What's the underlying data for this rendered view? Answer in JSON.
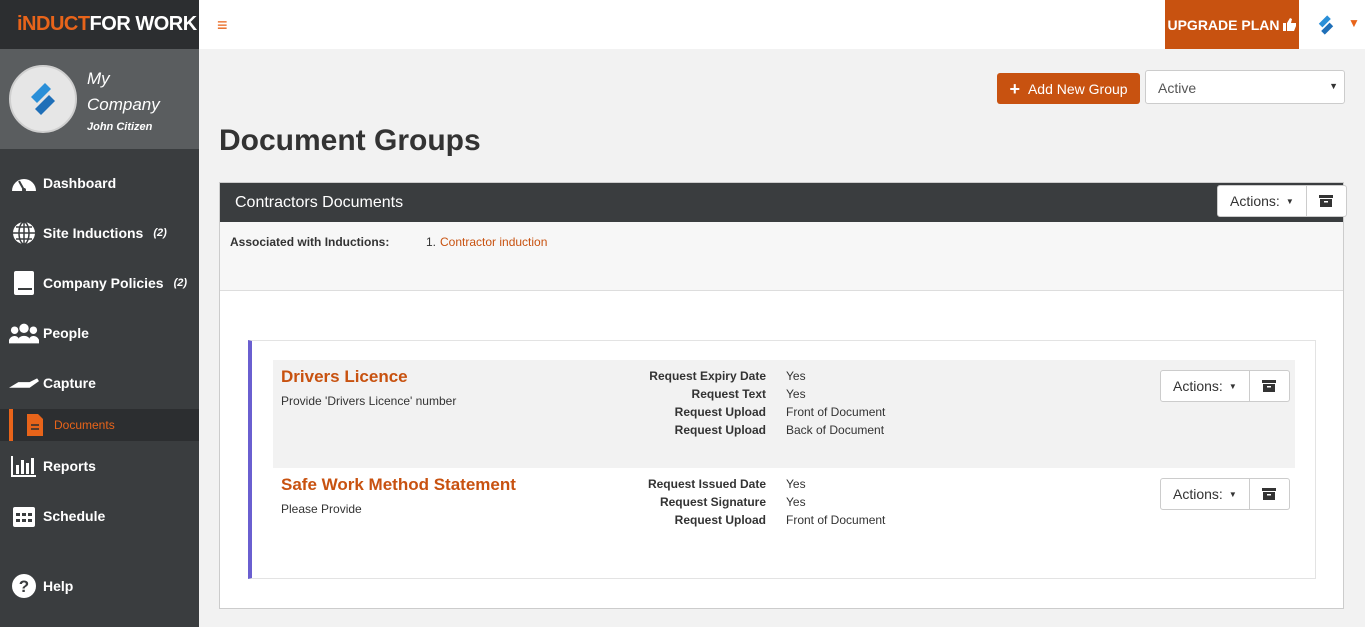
{
  "brand": {
    "part1": "iNDUCT",
    "part2": "FOR WORK"
  },
  "profile": {
    "company": "My Company",
    "user": "John Citizen"
  },
  "nav": {
    "dashboard": "Dashboard",
    "site_inductions": "Site Inductions",
    "site_inductions_count": "(2)",
    "company_policies": "Company Policies",
    "company_policies_count": "(2)",
    "people": "People",
    "capture": "Capture",
    "documents": "Documents",
    "reports": "Reports",
    "schedule": "Schedule",
    "help": "Help"
  },
  "topbar": {
    "menu_glyph": "≡",
    "upgrade_label": "UPGRADE PLAN"
  },
  "toolbar": {
    "add_group_label": "Add New Group",
    "status_value": "Active"
  },
  "page": {
    "title": "Document Groups"
  },
  "group": {
    "name": "Contractors Documents",
    "actions_label": "Actions:",
    "assoc_label": "Associated with Inductions:",
    "assoc_index": "1.",
    "assoc_link": "Contractor induction"
  },
  "documents": [
    {
      "title": "Drivers Licence",
      "desc": "Provide 'Drivers Licence' number",
      "actions_label": "Actions:",
      "props": [
        {
          "k": "Request Expiry Date",
          "v": "Yes"
        },
        {
          "k": "Request Text",
          "v": "Yes"
        },
        {
          "k": "Request Upload",
          "v": "Front of Document"
        },
        {
          "k": "Request Upload",
          "v": "Back of Document"
        }
      ]
    },
    {
      "title": "Safe Work Method Statement",
      "desc": "Please Provide",
      "actions_label": "Actions:",
      "props": [
        {
          "k": "Request Issued Date",
          "v": "Yes"
        },
        {
          "k": "Request Signature",
          "v": "Yes"
        },
        {
          "k": "Request Upload",
          "v": "Front of Document"
        }
      ]
    }
  ],
  "colors": {
    "accent": "#c85210",
    "sidebar": "#3a3d3f",
    "group_stripe": "#6a5fd0"
  }
}
